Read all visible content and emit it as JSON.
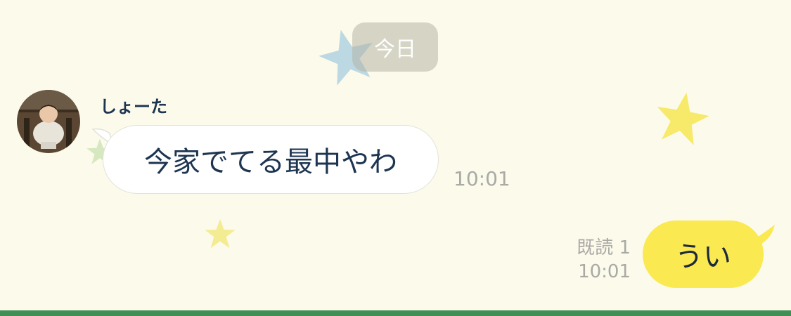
{
  "date_separator": {
    "label": "今日"
  },
  "incoming_message": {
    "sender": "しょーた",
    "text": "今家でてる最中やわ",
    "time": "10:01"
  },
  "outgoing_message": {
    "text": "うい",
    "read_receipt": "既読 1",
    "time": "10:01"
  },
  "colors": {
    "background": "#fcfaeb",
    "outgoing_bubble": "#fbe952",
    "incoming_bubble": "#ffffff",
    "bottom_bar": "#3f8f57",
    "text_dark": "#1d3551"
  },
  "icons": [
    "star-icon",
    "avatar-photo"
  ]
}
